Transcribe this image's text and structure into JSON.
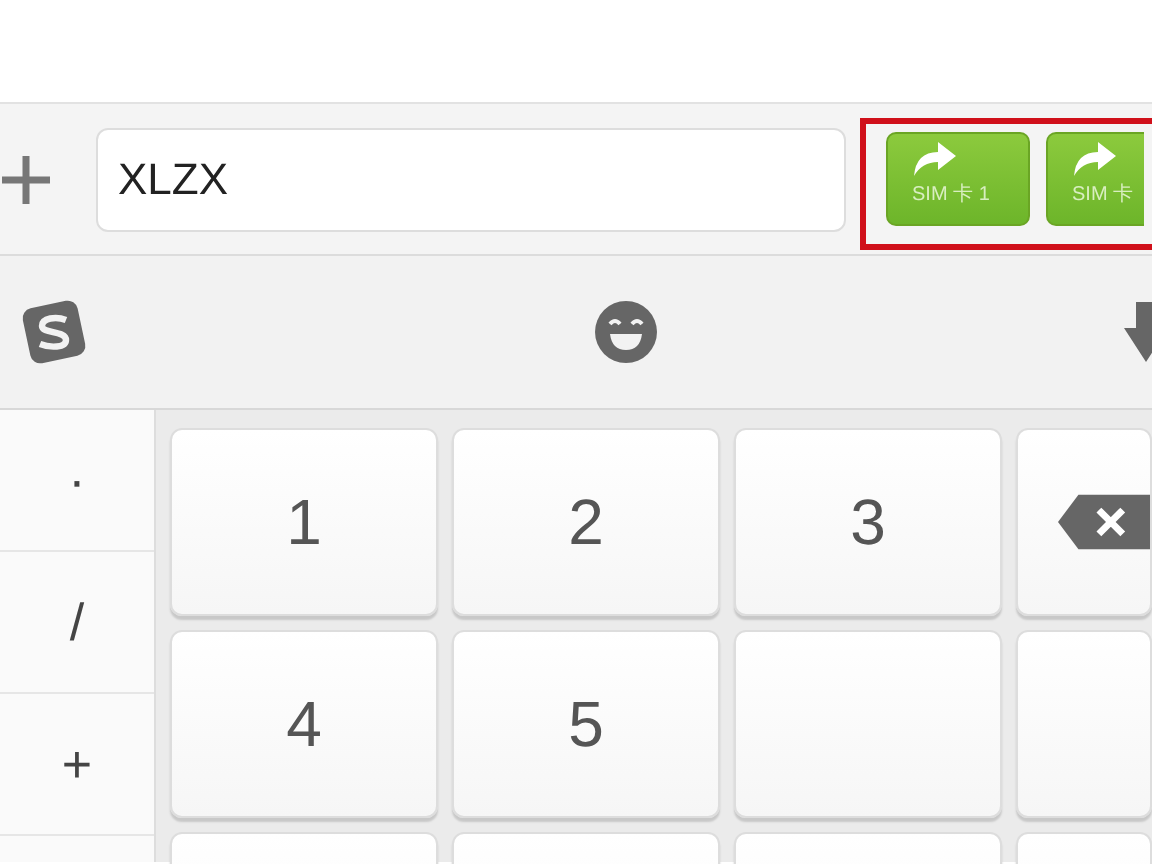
{
  "compose": {
    "value": "XLZX",
    "highlighted": true,
    "send_buttons": [
      {
        "label": "SIM 卡 1"
      },
      {
        "label": "SIM 卡"
      }
    ]
  },
  "keyboard": {
    "symbols": [
      "·",
      "/",
      "+"
    ],
    "keys": [
      {
        "kind": "digit",
        "label": "1"
      },
      {
        "kind": "digit",
        "label": "2"
      },
      {
        "kind": "digit",
        "label": "3"
      },
      {
        "kind": "backspace"
      },
      {
        "kind": "digit",
        "label": "4"
      },
      {
        "kind": "digit",
        "label": "5"
      },
      {
        "kind": "blank"
      },
      {
        "kind": "blank"
      },
      {
        "kind": "blank"
      },
      {
        "kind": "blank"
      },
      {
        "kind": "blank"
      },
      {
        "kind": "blank"
      }
    ]
  }
}
